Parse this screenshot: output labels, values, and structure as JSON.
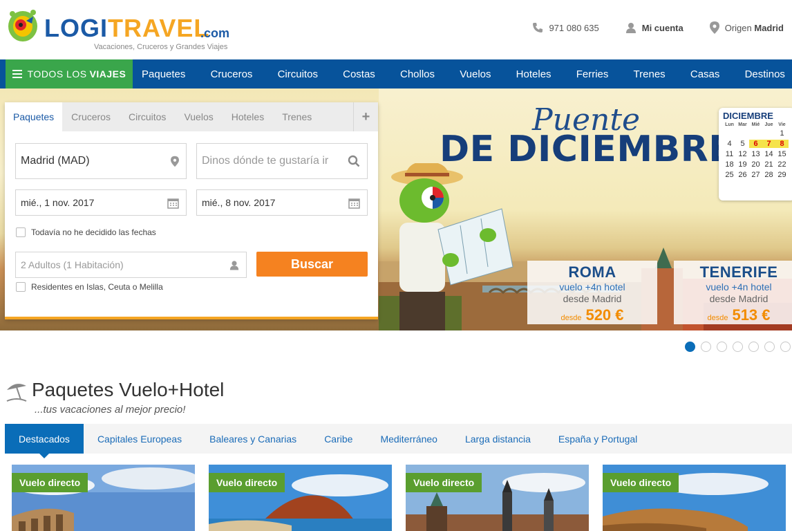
{
  "brand": {
    "logo_part1": "LOGI",
    "logo_part2": "TRAVEL",
    "logo_suffix": ".com",
    "tagline": "Vacaciones, Cruceros y Grandes Viajes",
    "colors": {
      "primary": "#07539b",
      "accent": "#f5a623",
      "green": "#3aa64b",
      "orange": "#f58220"
    }
  },
  "top_links": {
    "phone": "971 080 635",
    "account": "Mi cuenta",
    "origin_label": "Origen",
    "origin_value": "Madrid"
  },
  "nav": {
    "all_trips_prefix": "TODOS LOS",
    "all_trips_bold": "VIAJES",
    "items": [
      "Paquetes",
      "Cruceros",
      "Circuitos",
      "Costas",
      "Chollos",
      "Vuelos",
      "Hoteles",
      "Ferries",
      "Trenes",
      "Casas",
      "Destinos"
    ]
  },
  "search": {
    "tabs": [
      "Paquetes",
      "Cruceros",
      "Circuitos",
      "Vuelos",
      "Hoteles",
      "Trenes"
    ],
    "active_tab": "Paquetes",
    "plus": "+",
    "origin_value": "Madrid (MAD)",
    "destination_placeholder": "Dinos dónde te gustaría ir",
    "date_from": "mié., 1 nov. 2017",
    "date_to": "mié., 8 nov. 2017",
    "undecided_dates": "Todavía no he decidido las fechas",
    "guests_placeholder": "2 Adultos (1 Habitación)",
    "search_button": "Buscar",
    "residents": "Residentes en Islas, Ceuta o Melilla"
  },
  "hero": {
    "title_line1": "Puente",
    "title_line2": "DE DICIEMBRE",
    "calendar": {
      "month": "DICIEMBRE",
      "weekdays": [
        "Lun",
        "Mar",
        "Mié",
        "Jue",
        "Vie"
      ],
      "rows": [
        [
          "",
          "",
          "",
          "",
          "1"
        ],
        [
          "4",
          "5",
          "6",
          "7",
          "8"
        ],
        [
          "11",
          "12",
          "13",
          "14",
          "15"
        ],
        [
          "18",
          "19",
          "20",
          "21",
          "22"
        ],
        [
          "25",
          "26",
          "27",
          "28",
          "29"
        ]
      ],
      "highlighted": [
        "6",
        "7",
        "8"
      ]
    },
    "promos": [
      {
        "city": "ROMA",
        "desc": "vuelo +4n hotel",
        "from_city": "desde Madrid",
        "from_label": "desde",
        "price": "520 €"
      },
      {
        "city": "TENERIFE",
        "desc": "vuelo +4n hotel",
        "from_city": "desde Madrid",
        "from_label": "desde",
        "price": "513 €"
      }
    ],
    "carousel_dots": 7,
    "active_dot": 0
  },
  "section": {
    "title": "Paquetes Vuelo+Hotel",
    "subtitle": "...tus vacaciones al mejor precio!",
    "categories": [
      "Destacados",
      "Capitales Europeas",
      "Baleares y Canarias",
      "Caribe",
      "Mediterráneo",
      "Larga distancia",
      "España y Portugal"
    ],
    "active_category": "Destacados",
    "cards": [
      {
        "badge": "Vuelo directo"
      },
      {
        "badge": "Vuelo directo"
      },
      {
        "badge": "Vuelo directo"
      },
      {
        "badge": "Vuelo directo"
      }
    ]
  },
  "icons": {
    "phone": "phone-icon",
    "account": "user-icon",
    "origin": "location-pin-icon",
    "menu": "hamburger-icon",
    "search": "magnifier-icon",
    "calendar": "calendar-icon",
    "guests": "user-icon",
    "section": "beach-umbrella-icon"
  }
}
